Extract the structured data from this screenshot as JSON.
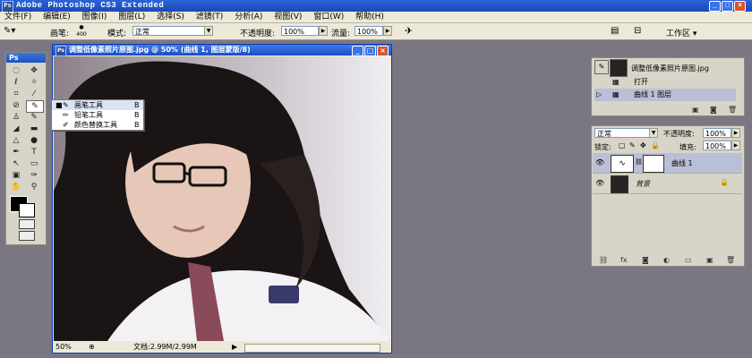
{
  "app": {
    "title": "Adobe Photoshop CS3 Extended",
    "logo": "Ps"
  },
  "window_controls": {
    "minimize": "_",
    "maximize": "□",
    "close": "×"
  },
  "menu": [
    "文件(F)",
    "编辑(E)",
    "图像(I)",
    "图层(L)",
    "选择(S)",
    "滤镜(T)",
    "分析(A)",
    "视图(V)",
    "窗口(W)",
    "帮助(H)"
  ],
  "options": {
    "brush_label": "画笔:",
    "brush_size": "400",
    "mode_label": "模式:",
    "mode_value": "正常",
    "opacity_label": "不透明度:",
    "opacity_value": "100%",
    "flow_label": "流量:",
    "flow_value": "100%",
    "workspace": "工作区 ▾"
  },
  "toolbox": {
    "header": "Ps"
  },
  "flyout": {
    "items": [
      {
        "label": "画笔工具",
        "key": "B",
        "selected": true
      },
      {
        "label": "铅笔工具",
        "key": "B",
        "selected": false
      },
      {
        "label": "颜色替换工具",
        "key": "B",
        "selected": false
      }
    ]
  },
  "document": {
    "title": "调整低像素照片原图.jpg @ 50% (曲线 1, 图层蒙版/8)",
    "zoom": "50%",
    "doc_size": "文档:2.99M/2.99M"
  },
  "history": {
    "snapshot_name": "调整低像素照片原图.jpg",
    "items": [
      "打开",
      "曲线 1 图层"
    ]
  },
  "layers": {
    "blend_mode": "正常",
    "opacity_label": "不透明度:",
    "opacity_value": "100%",
    "lock_label": "锁定:",
    "fill_label": "填充:",
    "fill_value": "100%",
    "items": [
      {
        "name": "曲线 1",
        "selected": true
      },
      {
        "name": "背景",
        "selected": false
      }
    ]
  },
  "colors": {
    "title_blue": "#1f52c0",
    "workspace_gray": "#7b7782",
    "panel_bg": "#d8d4c8",
    "selected_row": "#b9bfd6"
  }
}
